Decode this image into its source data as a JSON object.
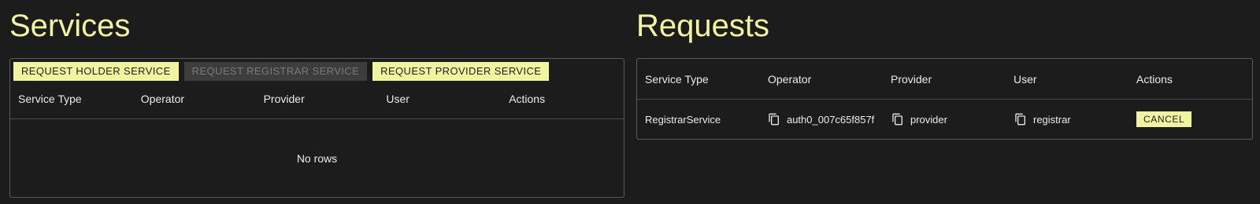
{
  "services": {
    "title": "Services",
    "buttons": [
      {
        "label": "REQUEST HOLDER SERVICE",
        "enabled": true
      },
      {
        "label": "REQUEST REGISTRAR SERVICE",
        "enabled": false
      },
      {
        "label": "REQUEST PROVIDER SERVICE",
        "enabled": true
      }
    ],
    "columns": [
      "Service Type",
      "Operator",
      "Provider",
      "User",
      "Actions"
    ],
    "empty_text": "No rows"
  },
  "requests": {
    "title": "Requests",
    "columns": [
      "Service Type",
      "Operator",
      "Provider",
      "User",
      "Actions"
    ],
    "rows": [
      {
        "service_type": "RegistrarService",
        "operator": "auth0_007c65f857f",
        "provider": "provider",
        "user": "registrar",
        "action_label": "CANCEL"
      }
    ]
  },
  "theme": {
    "accent": "#f2f5a0",
    "background": "#1c1c1c",
    "border": "#5a5a5a"
  },
  "icons": {
    "copy": "copy-icon"
  }
}
